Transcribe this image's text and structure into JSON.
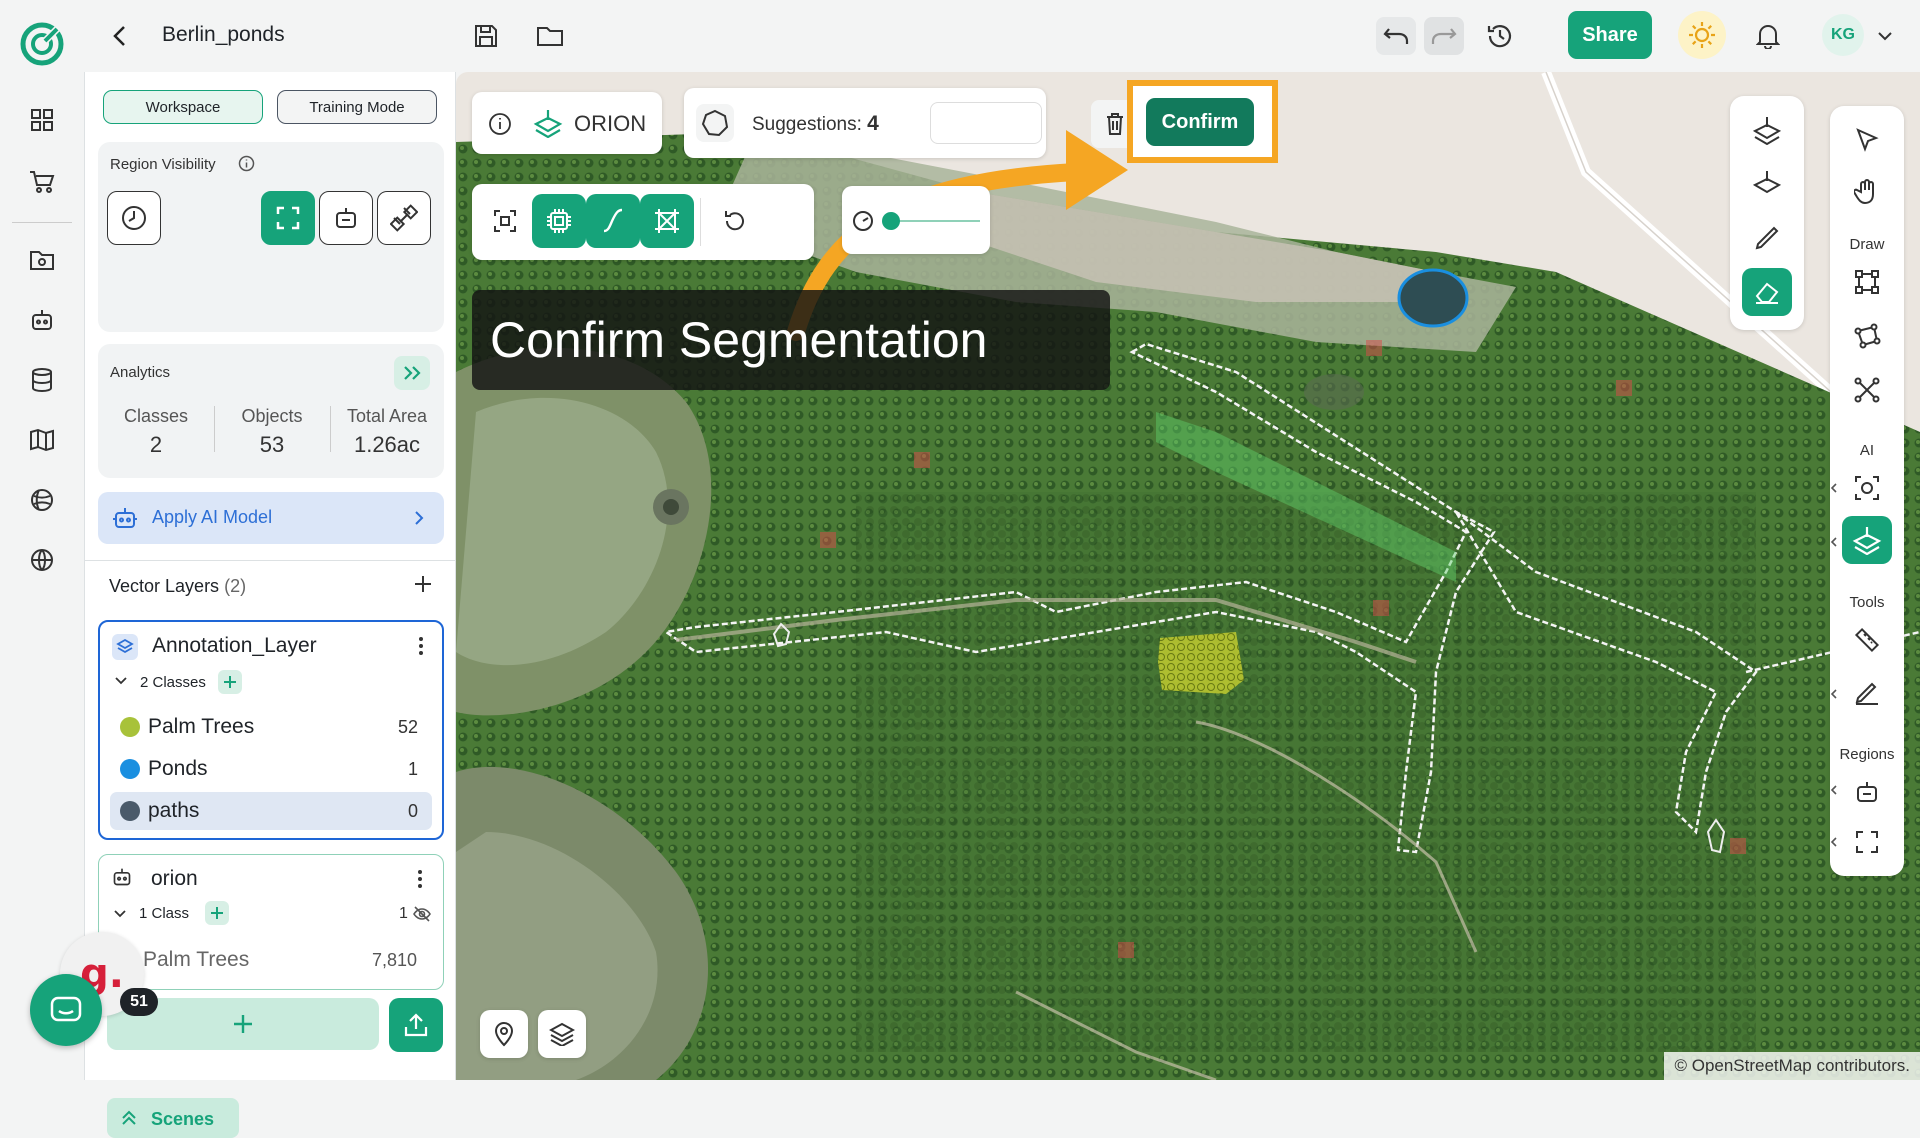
{
  "app": {
    "project_title": "Berlin_ponds",
    "share_label": "Share",
    "user_initials": "KG"
  },
  "panel": {
    "tabs": [
      "Workspace",
      "Training Mode"
    ],
    "region_visibility_label": "Region Visibility",
    "analytics": {
      "title": "Analytics",
      "stats": [
        {
          "label": "Classes",
          "value": "2"
        },
        {
          "label": "Objects",
          "value": "53"
        },
        {
          "label": "Total Area",
          "value": "1.26ac"
        }
      ]
    },
    "apply_ai_label": "Apply AI Model",
    "vector_layers": {
      "title": "Vector Layers",
      "count": "(2)"
    },
    "layers": [
      {
        "name": "Annotation_Layer",
        "classes_label": "2 Classes",
        "classes": [
          {
            "name": "Palm Trees",
            "count": "52",
            "color": "#a8c23a"
          },
          {
            "name": "Ponds",
            "count": "1",
            "color": "#1a8fe0"
          },
          {
            "name": "paths",
            "count": "0",
            "color": "#4a5a6a"
          }
        ]
      },
      {
        "name": "orion",
        "classes_label": "1 Class",
        "hidden_count": "1",
        "classes": [
          {
            "name": "Palm Trees",
            "count": "7,810"
          }
        ]
      }
    ],
    "scenes_label": "Scenes",
    "badge_count": "51"
  },
  "map": {
    "orion_label": "ORION",
    "suggestions_label": "Suggestions:",
    "suggestions_count": "4",
    "confirm_label": "Confirm",
    "callout": "Confirm Segmentation",
    "attribution": "© OpenStreetMap contributors."
  },
  "right_toolbar": {
    "sections": [
      "Draw",
      "AI",
      "Tools",
      "Regions"
    ]
  },
  "colors": {
    "accent": "#16a37a",
    "highlight": "#f5a623",
    "layer_border": "#1e66d6"
  }
}
